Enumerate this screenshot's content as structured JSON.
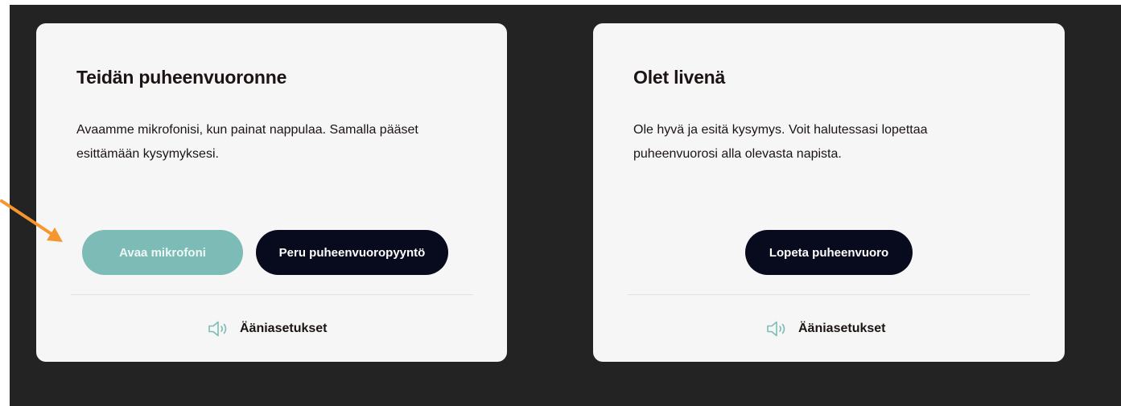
{
  "colors": {
    "backdrop": "#232323",
    "card": "#f6f6f6",
    "primary_button": "#7dbcb6",
    "dark_button": "#080a1e",
    "text": "#1c1413",
    "arrow": "#f5962e",
    "speaker_icon": "#7dbcb6"
  },
  "left_card": {
    "title": "Teidän puheenvuoronne",
    "body": "Avaamme mikrofonisi, kun painat nappulaa. Samalla pääset esittämään kysymyksesi.",
    "open_mic_label": "Avaa mikrofoni",
    "cancel_label": "Peru puheenvuoropyyntö",
    "audio_settings_label": "Ääniasetukset",
    "audio_icon": "speaker-icon"
  },
  "right_card": {
    "title": "Olet livenä",
    "body": "Ole hyvä ja esitä kysymys. Voit halutessasi lopettaa puheenvuorosi alla olevasta napista.",
    "end_label": "Lopeta puheenvuoro",
    "audio_settings_label": "Ääniasetukset",
    "audio_icon": "speaker-icon"
  },
  "annotation": {
    "icon": "pointer-arrow-icon"
  }
}
